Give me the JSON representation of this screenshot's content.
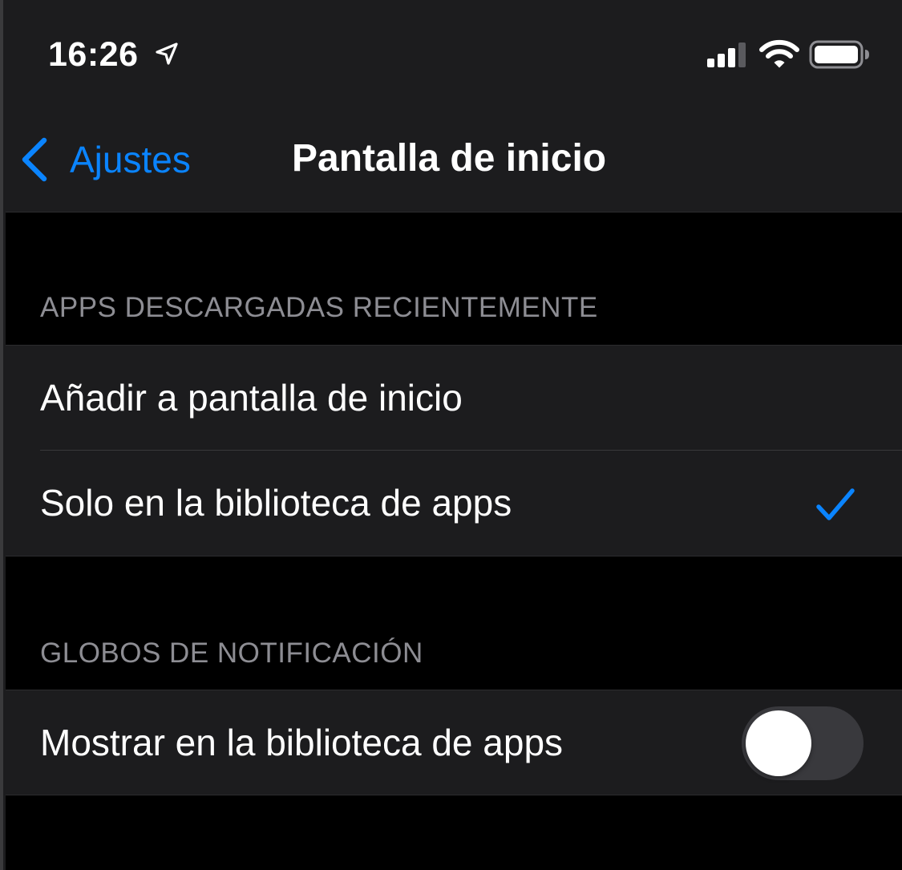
{
  "status_bar": {
    "time": "16:26",
    "icons": [
      "location-arrow-icon",
      "cellular-signal-icon",
      "wifi-icon",
      "battery-icon"
    ]
  },
  "nav": {
    "back_label": "Ajustes",
    "title": "Pantalla de inicio"
  },
  "sections": [
    {
      "header": "APPS DESCARGADAS RECIENTEMENTE",
      "rows": [
        {
          "label": "Añadir a pantalla de inicio",
          "selected": false
        },
        {
          "label": "Solo en la biblioteca de apps",
          "selected": true
        }
      ]
    },
    {
      "header": "GLOBOS DE NOTIFICACIÓN",
      "rows": [
        {
          "label": "Mostrar en la biblioteca de apps",
          "toggle": false
        }
      ]
    }
  ],
  "colors": {
    "background": "#000000",
    "cell": "#1c1c1e",
    "accent": "#0a84ff",
    "section_header": "#8d8d93",
    "toggle_off": "#39393d"
  }
}
